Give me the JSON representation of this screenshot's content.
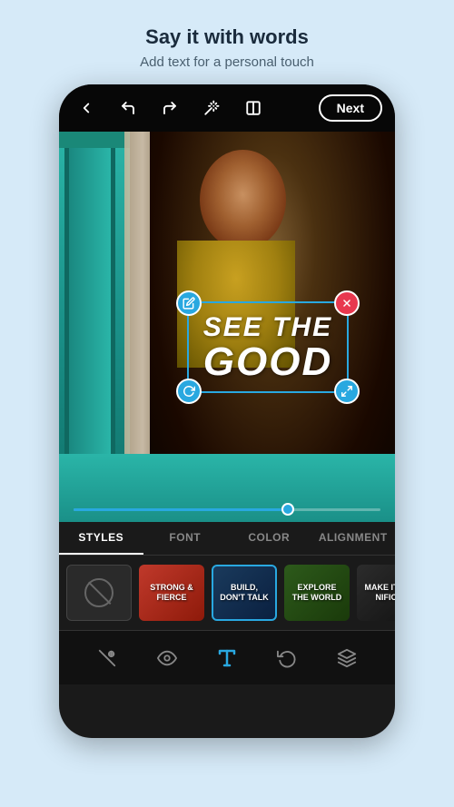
{
  "header": {
    "title": "Say it with words",
    "subtitle": "Add text for a personal touch"
  },
  "topbar": {
    "next_label": "Next"
  },
  "text_overlay": {
    "line1": "SEE THE",
    "line2": "GOOD"
  },
  "slider": {
    "value": 72
  },
  "tabs": [
    {
      "id": "styles",
      "label": "STYLES",
      "active": true
    },
    {
      "id": "font",
      "label": "FONT",
      "active": false
    },
    {
      "id": "color",
      "label": "COLOR",
      "active": false
    },
    {
      "id": "alignment",
      "label": "ALIGNMENT",
      "active": false
    }
  ],
  "style_thumbnails": [
    {
      "id": "none",
      "label": "",
      "type": "none"
    },
    {
      "id": "strong",
      "label": "STRONG & FIERCE",
      "type": "strong"
    },
    {
      "id": "build",
      "label": "BUILD, DON'T TALK",
      "type": "build",
      "active": true
    },
    {
      "id": "explore",
      "label": "EXPLORE THE WORLD",
      "type": "explore"
    },
    {
      "id": "make",
      "label": "MAKE IT SIG... SIGNIFIC...",
      "type": "make"
    }
  ],
  "toolbar": {
    "items": [
      {
        "id": "wand",
        "icon": "wand"
      },
      {
        "id": "eye",
        "icon": "eye"
      },
      {
        "id": "text",
        "icon": "text",
        "active": true
      },
      {
        "id": "history",
        "icon": "history"
      },
      {
        "id": "layers",
        "icon": "layers"
      }
    ]
  }
}
